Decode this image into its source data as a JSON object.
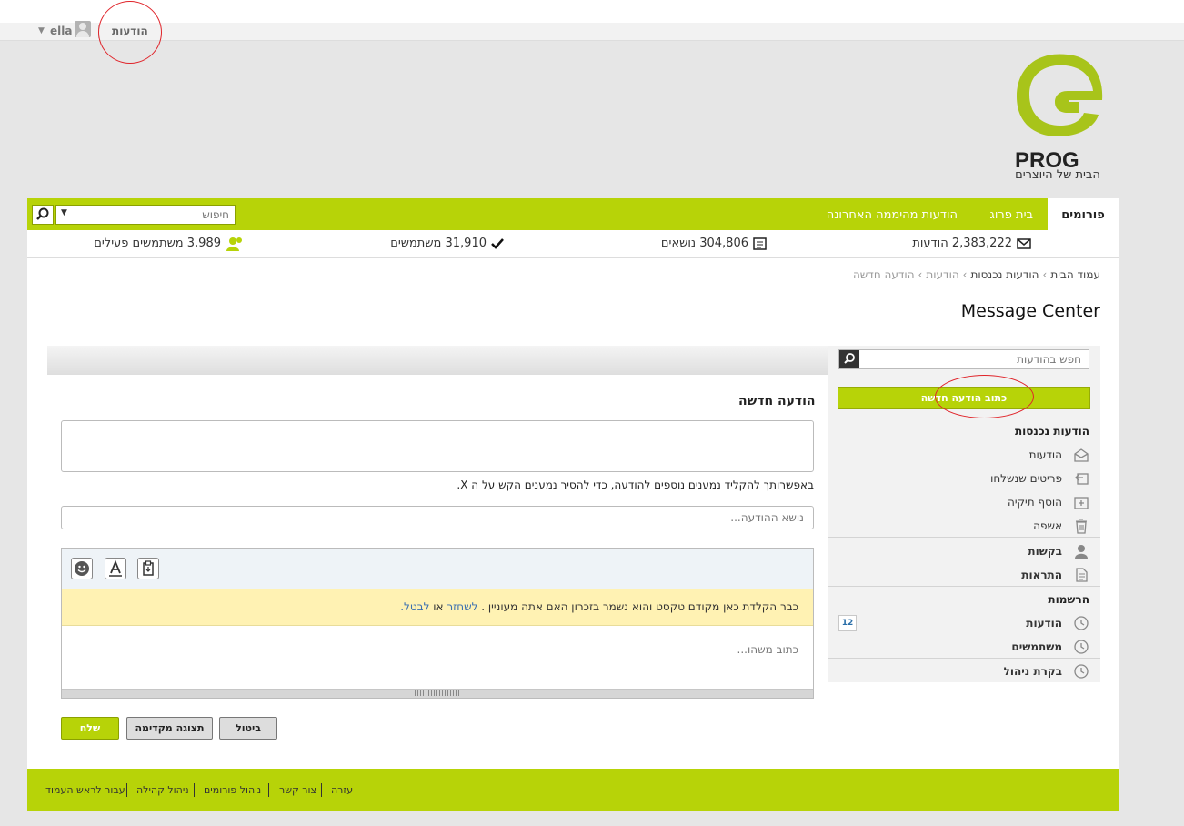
{
  "top_bar": {
    "user_name": "ella",
    "messages_link": "הודעות"
  },
  "logo": {
    "wordmark": "PROG",
    "tagline": "הבית של היוצרים"
  },
  "nav": {
    "forums": "פורומים",
    "home": "בית פרוג",
    "latest": "הודעות מהיממה האחרונה",
    "search_placeholder": "חיפוש"
  },
  "stats": {
    "messages": "2,383,222 הודעות",
    "topics": "304,806 נושאים",
    "members": "31,910 משתמשים",
    "active": "3,989 משתמשים פעילים"
  },
  "breadcrumb": [
    "עמוד הבית",
    "הודעות נכנסות",
    "הודעות",
    "הודעה חדשה"
  ],
  "page_title": "Message Center",
  "sidebar": {
    "search_placeholder": "חפש בהודעות",
    "compose": "כתוב הודעה חדשה",
    "inbox_header": "הודעות נכנסות",
    "items": {
      "messages": "הודעות",
      "sent": "פריטים שנשלחו",
      "add_folder": "הוסף תיקיה",
      "trash": "אשפה"
    },
    "requests": "בקשות",
    "alerts": "התראות",
    "subscriptions_header": "הרשמות",
    "sub_messages": "הודעות",
    "sub_messages_count": "12",
    "sub_users": "משתמשים",
    "mod_review": "בקרת ניהול"
  },
  "compose": {
    "title": "הודעה חדשה",
    "hint": "באפשרותך להקליד נמענים נוספים להודעה, כדי להסיר נמענים הקש על ה X.",
    "subject_placeholder": "נושא ההודעה...",
    "restore_text": "כבר הקלדת כאן מקודם טקסט והוא נשמר בזכרון האם אתה מעוניין .",
    "restore_link": "לשחזר",
    "restore_or": "או",
    "cancel_link": "לבטל.",
    "body_placeholder": "כתוב משהו...",
    "send": "שלח",
    "preview": "תצוגה מקדימה",
    "cancel": "ביטול"
  },
  "footer": {
    "help": "עזרה",
    "contact": "צור קשר",
    "forum_admin": "ניהול פורומים",
    "community_admin": "ניהול קהילה",
    "top": "עבור לראש העמוד"
  },
  "colors": {
    "brand_green": "#b7d308",
    "annotation_red": "#e0242a"
  }
}
